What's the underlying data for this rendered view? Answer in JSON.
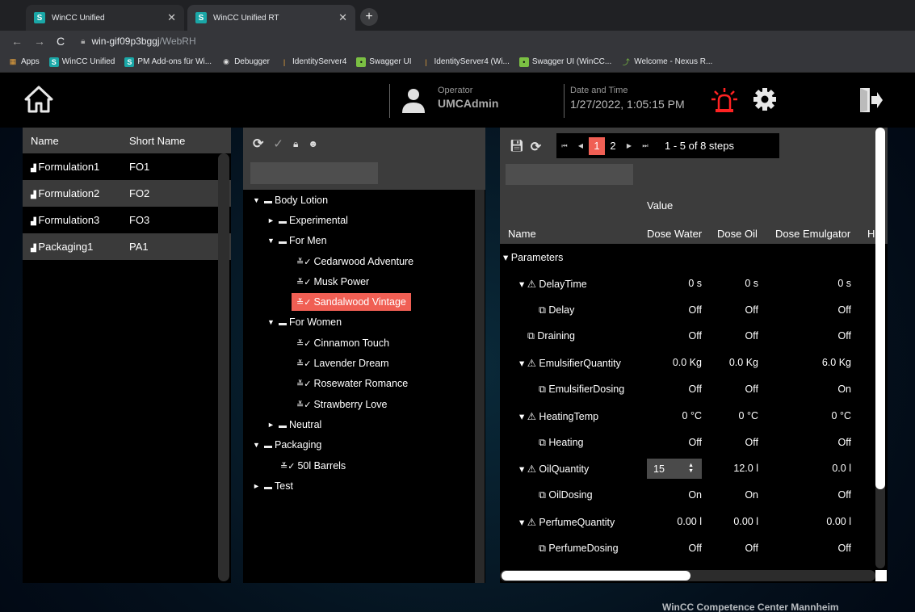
{
  "browser": {
    "tabs": [
      {
        "label": "WinCC Unified",
        "icon": "S"
      },
      {
        "label": "WinCC Unified RT",
        "icon": "S"
      }
    ],
    "url_host": "win-gif09p3bggj",
    "url_path": "/WebRH",
    "bookmarks": [
      {
        "label": "Apps",
        "icon": "apps-grid-icon"
      },
      {
        "label": "WinCC Unified",
        "icon": "siemens-icon"
      },
      {
        "label": "PM Add-ons für Wi...",
        "icon": "siemens-icon"
      },
      {
        "label": "Debugger",
        "icon": "globe-icon"
      },
      {
        "label": "IdentityServer4",
        "icon": "bar-icon"
      },
      {
        "label": "Swagger UI",
        "icon": "swagger-icon"
      },
      {
        "label": "IdentityServer4 (Wi...",
        "icon": "bar-icon"
      },
      {
        "label": "Swagger UI (WinCC...",
        "icon": "swagger-icon"
      },
      {
        "label": "Welcome - Nexus R...",
        "icon": "nexus-icon"
      }
    ]
  },
  "header": {
    "operator_label": "Operator",
    "operator_value": "UMCAdmin",
    "datetime_label": "Date and Time",
    "datetime_value": "1/27/2022, 1:05:15 PM",
    "alarm_color": "#ff2222"
  },
  "recipe_list": {
    "columns": [
      "Name",
      "Short Name"
    ],
    "rows": [
      {
        "name": "Formulation1",
        "short": "FO1"
      },
      {
        "name": "Formulation2",
        "short": "FO2"
      },
      {
        "name": "Formulation3",
        "short": "FO3"
      },
      {
        "name": "Packaging1",
        "short": "PA1"
      }
    ]
  },
  "tree": {
    "nodes": [
      {
        "label": "Body Lotion",
        "arrow": "▼",
        "kind": "folder"
      },
      {
        "label": "Experimental",
        "arrow": "►",
        "kind": "folder"
      },
      {
        "label": "For Men",
        "arrow": "▼",
        "kind": "folder"
      },
      {
        "label": "Cedarwood Adventure",
        "arrow": "",
        "kind": "recipe"
      },
      {
        "label": "Musk Power",
        "arrow": "",
        "kind": "recipe"
      },
      {
        "label": "Sandalwood Vintage",
        "arrow": "",
        "kind": "recipe",
        "selected": true
      },
      {
        "label": "For Women",
        "arrow": "▼",
        "kind": "folder"
      },
      {
        "label": "Cinnamon Touch",
        "arrow": "",
        "kind": "recipe"
      },
      {
        "label": "Lavender Dream",
        "arrow": "",
        "kind": "recipe"
      },
      {
        "label": "Rosewater Romance",
        "arrow": "",
        "kind": "recipe"
      },
      {
        "label": "Strawberry Love",
        "arrow": "",
        "kind": "recipe"
      },
      {
        "label": "Neutral",
        "arrow": "►",
        "kind": "folder"
      },
      {
        "label": "Packaging",
        "arrow": "▼",
        "kind": "folder"
      },
      {
        "label": "50l Barrels",
        "arrow": "",
        "kind": "recipe"
      },
      {
        "label": "Test",
        "arrow": "►",
        "kind": "folder"
      }
    ]
  },
  "steps": {
    "pager": {
      "pages": [
        "1",
        "2"
      ],
      "active": "1",
      "info": "1 - 5 of 8 steps"
    },
    "value_header": "Value",
    "columns": [
      "Name",
      "Dose Water",
      "Dose Oil",
      "Dose Emulgator",
      "H"
    ],
    "rows": [
      {
        "name": "▾ Parameters",
        "v": [
          "",
          "",
          ""
        ]
      },
      {
        "name": "▾ ⚠ DelayTime",
        "v": [
          "0 s",
          "0 s",
          "0 s"
        ]
      },
      {
        "name": "⧉ Delay",
        "v": [
          "Off",
          "Off",
          "Off"
        ]
      },
      {
        "name": "⧉ Draining",
        "v": [
          "Off",
          "Off",
          "Off"
        ]
      },
      {
        "name": "▾ ⚠ EmulsifierQuantity",
        "v": [
          "0.0 Kg",
          "0.0 Kg",
          "6.0 Kg"
        ]
      },
      {
        "name": "⧉ EmulsifierDosing",
        "v": [
          "Off",
          "Off",
          "On"
        ]
      },
      {
        "name": "▾ ⚠ HeatingTemp",
        "v": [
          "0 °C",
          "0 °C",
          "0 °C"
        ]
      },
      {
        "name": "⧉ Heating",
        "v": [
          "Off",
          "Off",
          "Off"
        ]
      },
      {
        "name": "▾ ⚠ OilQuantity",
        "v": [
          "15",
          "12.0 l",
          "0.0 l"
        ]
      },
      {
        "name": "⧉ OilDosing",
        "v": [
          "On",
          "On",
          "Off"
        ]
      },
      {
        "name": "▾ ⚠ PerfumeQuantity",
        "v": [
          "0.00 l",
          "0.00 l",
          "0.00 l"
        ]
      },
      {
        "name": "⧉ PerfumeDosing",
        "v": [
          "Off",
          "Off",
          "Off"
        ]
      }
    ]
  },
  "footer": "WinCC Competence Center Mannheim",
  "colors": {
    "accent": "#f05f54",
    "panel": "#3c3c3c",
    "background": "#000000"
  }
}
